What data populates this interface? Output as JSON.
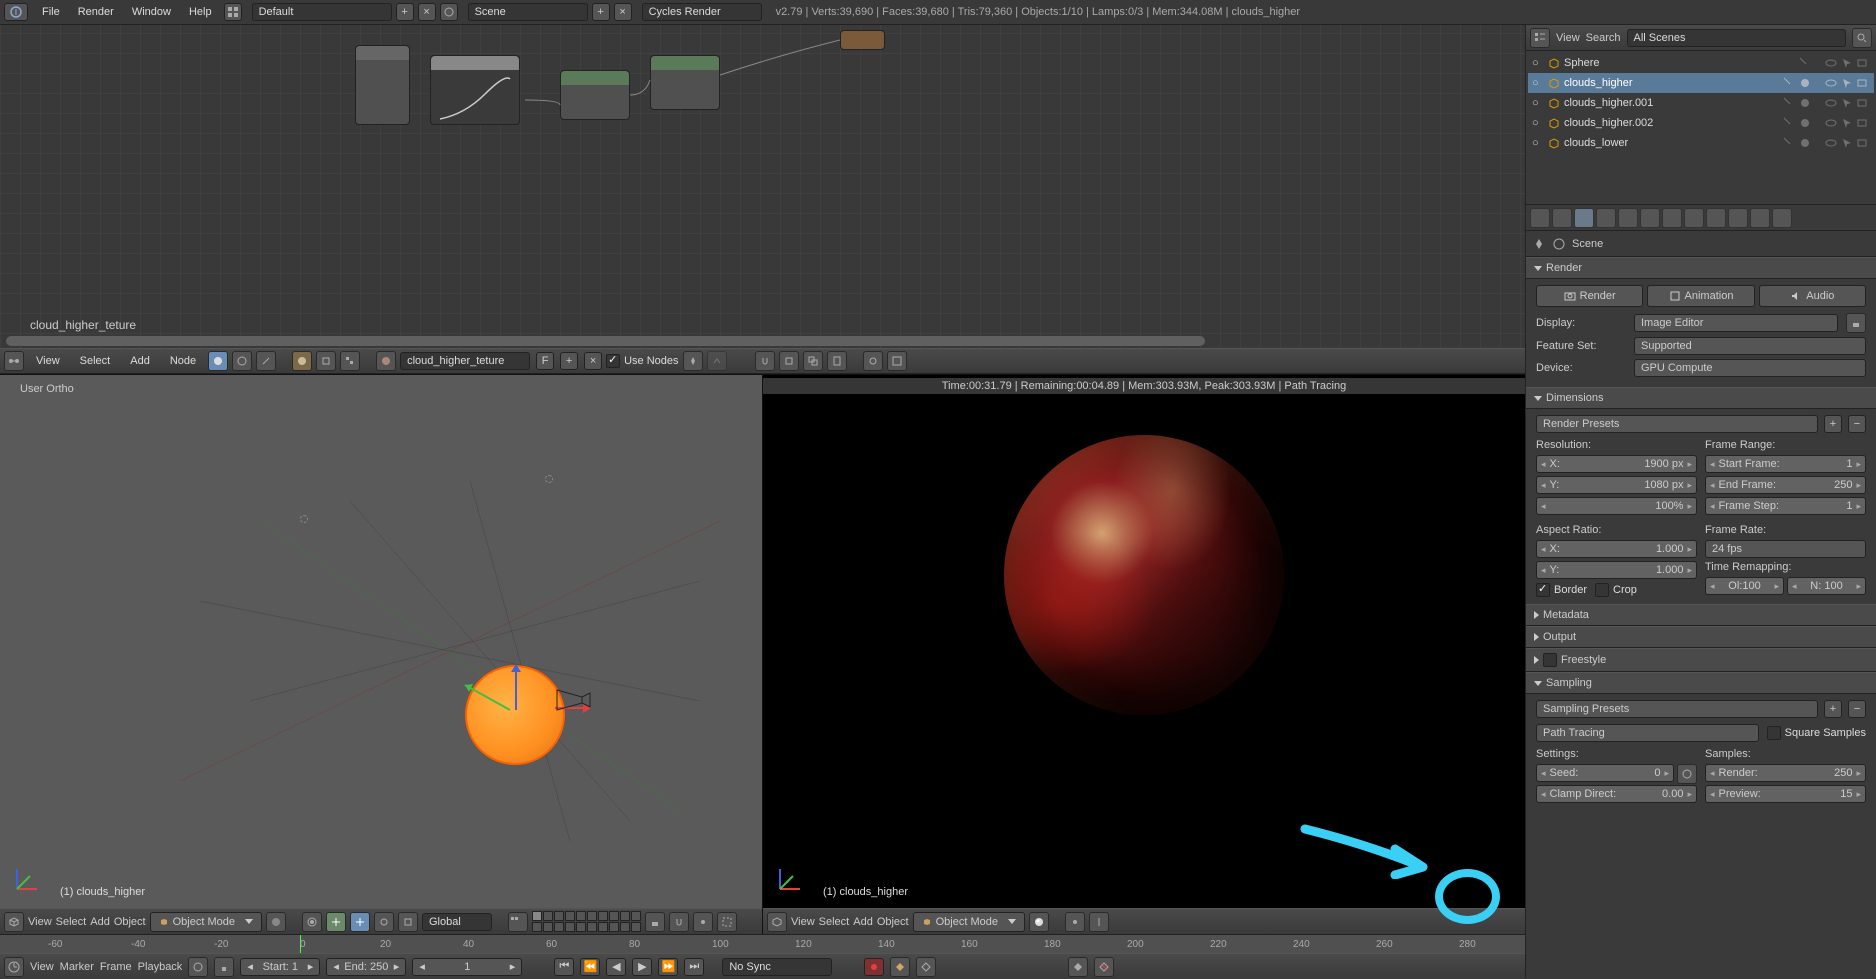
{
  "topbar": {
    "menus": [
      "File",
      "Render",
      "Window",
      "Help"
    ],
    "layout": "Default",
    "scene": "Scene",
    "engine": "Cycles Render",
    "stats": "v2.79 | Verts:39,690 | Faces:39,680 | Tris:79,360 | Objects:1/10 | Lamps:0/3 | Mem:344.08M | clouds_higher"
  },
  "node_editor": {
    "material_label": "cloud_higher_teture",
    "header": {
      "menus": [
        "View",
        "Select",
        "Add",
        "Node"
      ],
      "material_name": "cloud_higher_teture",
      "fake_user": "F",
      "use_nodes": "Use Nodes"
    }
  },
  "viewport_left": {
    "label": "User Ortho",
    "object": "(1) clouds_higher",
    "header": {
      "menus": [
        "View",
        "Select",
        "Add",
        "Object"
      ],
      "mode": "Object Mode",
      "orientation": "Global"
    }
  },
  "viewport_right": {
    "stats": "Time:00:31.79 | Remaining:00:04.89 | Mem:303.93M, Peak:303.93M | Path Tracing",
    "object": "(1) clouds_higher",
    "header": {
      "menus": [
        "View",
        "Select",
        "Add",
        "Object"
      ],
      "mode": "Object Mode"
    }
  },
  "timeline": {
    "ticks": [
      "-60",
      "-40",
      "-20",
      "0",
      "20",
      "40",
      "60",
      "80",
      "100",
      "120",
      "140",
      "160",
      "180",
      "200",
      "220",
      "240",
      "260",
      "280"
    ],
    "header": {
      "menus": [
        "View",
        "Marker",
        "Frame",
        "Playback"
      ],
      "start_label": "Start:",
      "start_val": "1",
      "end_label": "End:",
      "end_val": "250",
      "current": "1",
      "sync": "No Sync"
    }
  },
  "outliner": {
    "header": {
      "menus": [
        "View",
        "Search"
      ],
      "filter": "All Scenes"
    },
    "items": [
      {
        "name": "Sphere",
        "selected": false
      },
      {
        "name": "clouds_higher",
        "selected": true
      },
      {
        "name": "clouds_higher.001",
        "selected": false
      },
      {
        "name": "clouds_higher.002",
        "selected": false
      },
      {
        "name": "clouds_lower",
        "selected": false
      }
    ]
  },
  "properties": {
    "breadcrumb": "Scene",
    "render": {
      "title": "Render",
      "render_btn": "Render",
      "anim_btn": "Animation",
      "audio_btn": "Audio",
      "display_label": "Display:",
      "display_val": "Image Editor",
      "feature_label": "Feature Set:",
      "feature_val": "Supported",
      "device_label": "Device:",
      "device_val": "GPU Compute"
    },
    "dimensions": {
      "title": "Dimensions",
      "presets": "Render Presets",
      "res_label": "Resolution:",
      "frame_range_label": "Frame Range:",
      "x_label": "X:",
      "x_val": "1900 px",
      "y_label": "Y:",
      "y_val": "1080 px",
      "pct": "100%",
      "start_label": "Start Frame:",
      "start_val": "1",
      "end_label": "End Frame:",
      "end_val": "250",
      "step_label": "Frame Step:",
      "step_val": "1",
      "aspect_label": "Aspect Ratio:",
      "frame_rate_label": "Frame Rate:",
      "ax_label": "X:",
      "ax_val": "1.000",
      "ay_label": "Y:",
      "ay_val": "1.000",
      "fps": "24 fps",
      "remap_label": "Time Remapping:",
      "ol_label": "Ol:100",
      "nl_label": "N: 100",
      "border": "Border",
      "crop": "Crop"
    },
    "collapsed": {
      "metadata": "Metadata",
      "output": "Output",
      "freestyle": "Freestyle"
    },
    "sampling": {
      "title": "Sampling",
      "presets": "Sampling Presets",
      "integrator": "Path Tracing",
      "square": "Square Samples",
      "settings_label": "Settings:",
      "samples_label": "Samples:",
      "seed_label": "Seed:",
      "seed_val": "0",
      "clamp_label": "Clamp Direct:",
      "clamp_val": "0.00",
      "render_label": "Render:",
      "render_val": "250",
      "preview_label": "Preview:",
      "preview_val": "15"
    }
  }
}
